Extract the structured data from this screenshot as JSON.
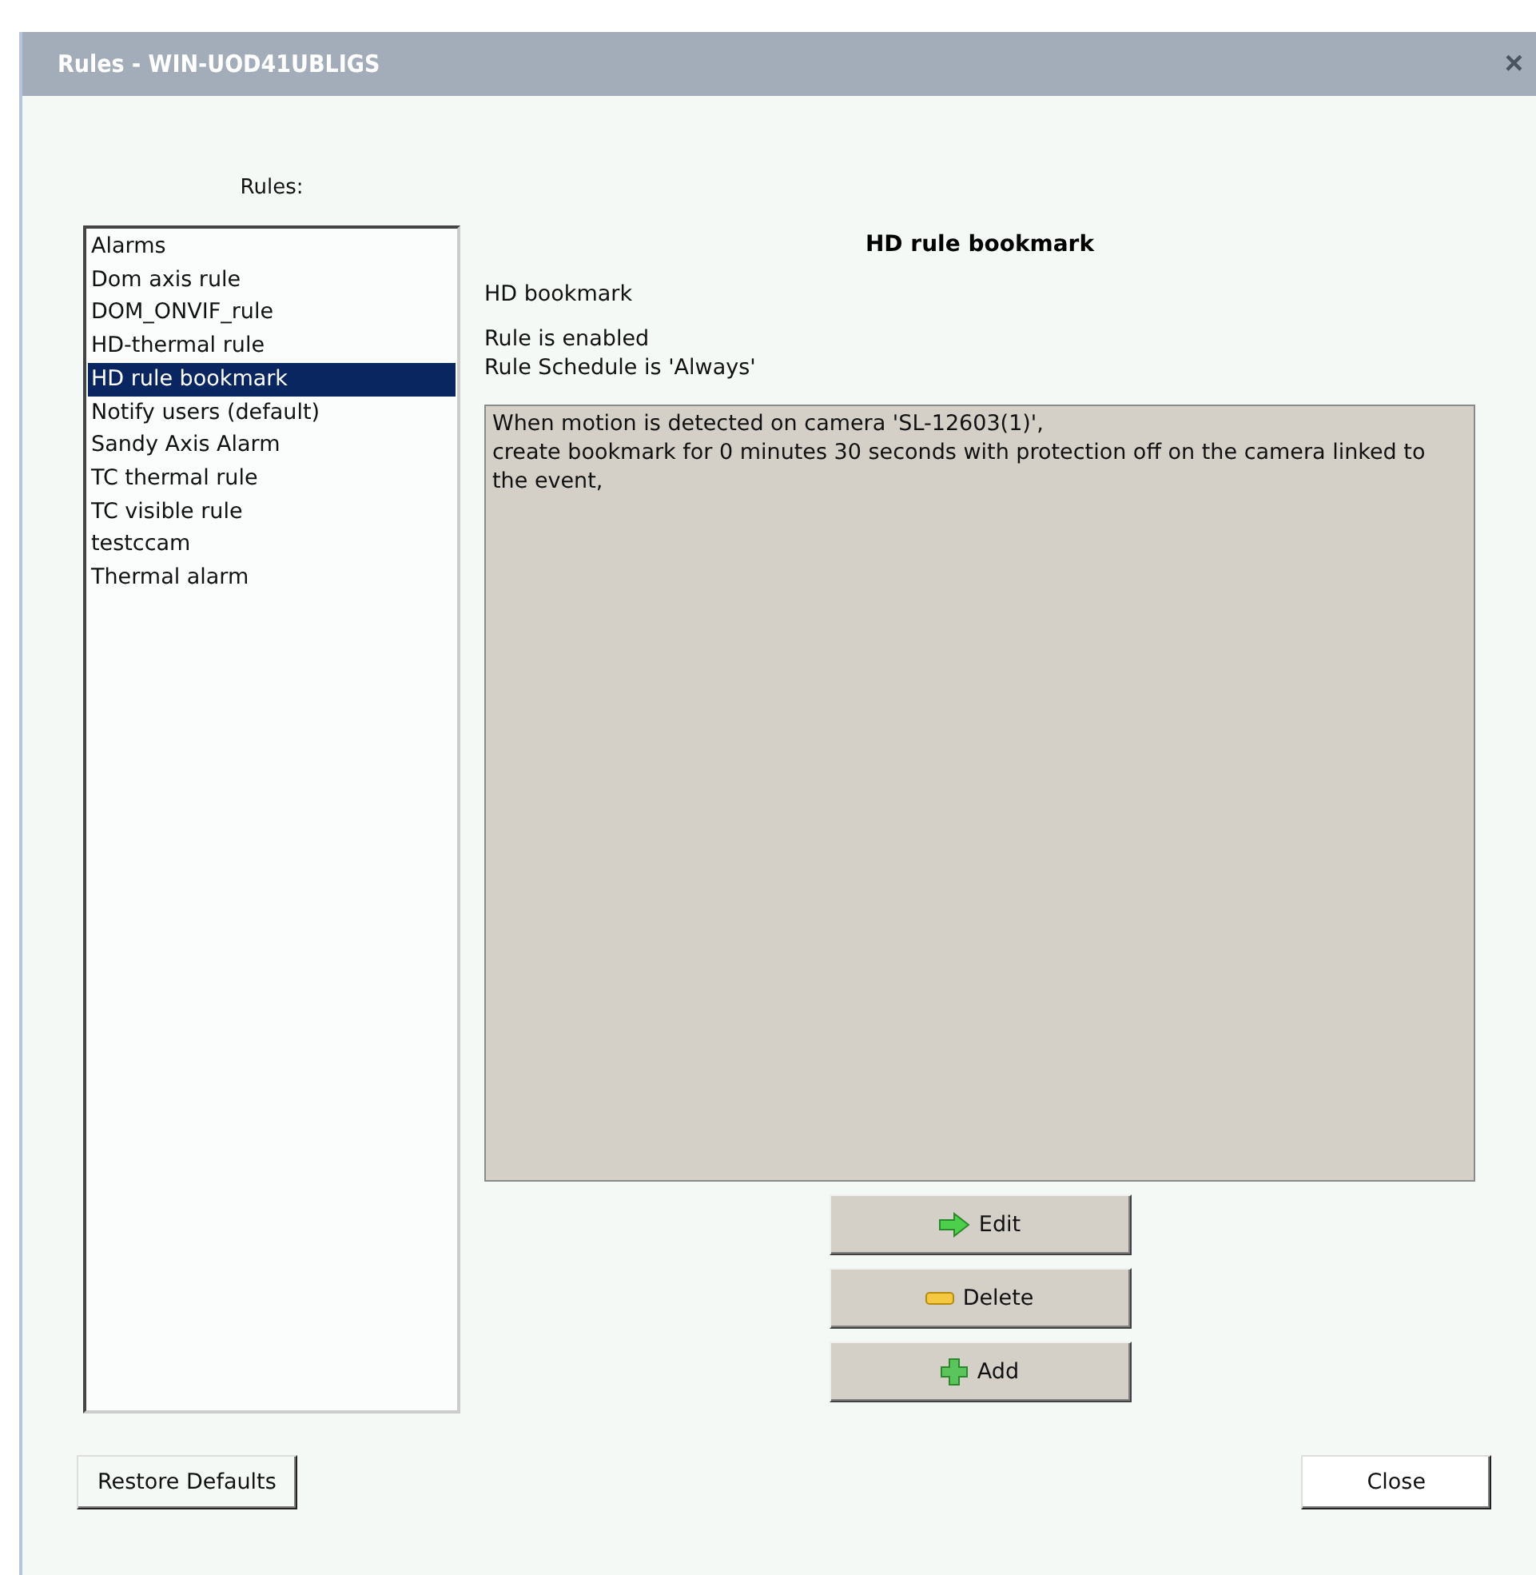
{
  "window": {
    "title": "Rules - WIN-UOD41UBLIGS",
    "close": "×"
  },
  "rules_label": "Rules:",
  "rules": [
    {
      "label": "Alarms",
      "selected": false
    },
    {
      "label": "Dom axis rule",
      "selected": false
    },
    {
      "label": "DOM_ONVIF_rule",
      "selected": false
    },
    {
      "label": "HD-thermal rule",
      "selected": false
    },
    {
      "label": "HD rule bookmark",
      "selected": true
    },
    {
      "label": "Notify users (default)",
      "selected": false
    },
    {
      "label": "Sandy Axis Alarm",
      "selected": false
    },
    {
      "label": "TC thermal rule",
      "selected": false
    },
    {
      "label": "TC visible rule",
      "selected": false
    },
    {
      "label": "testccam",
      "selected": false
    },
    {
      "label": "Thermal alarm",
      "selected": false
    }
  ],
  "detail": {
    "title": "HD rule bookmark",
    "description": "HD bookmark",
    "status": [
      "Rule is enabled",
      "Rule Schedule is 'Always'"
    ],
    "rule_text": [
      "When motion is detected on camera 'SL-12603(1)',",
      "create bookmark for 0 minutes 30 seconds with protection off on the camera linked to the event,"
    ]
  },
  "actions": [
    {
      "kind": "edit",
      "label": "Edit"
    },
    {
      "kind": "delete",
      "label": "Delete"
    },
    {
      "kind": "add",
      "label": "Add"
    }
  ],
  "footer": {
    "restore": "Restore Defaults",
    "close": "Close"
  }
}
